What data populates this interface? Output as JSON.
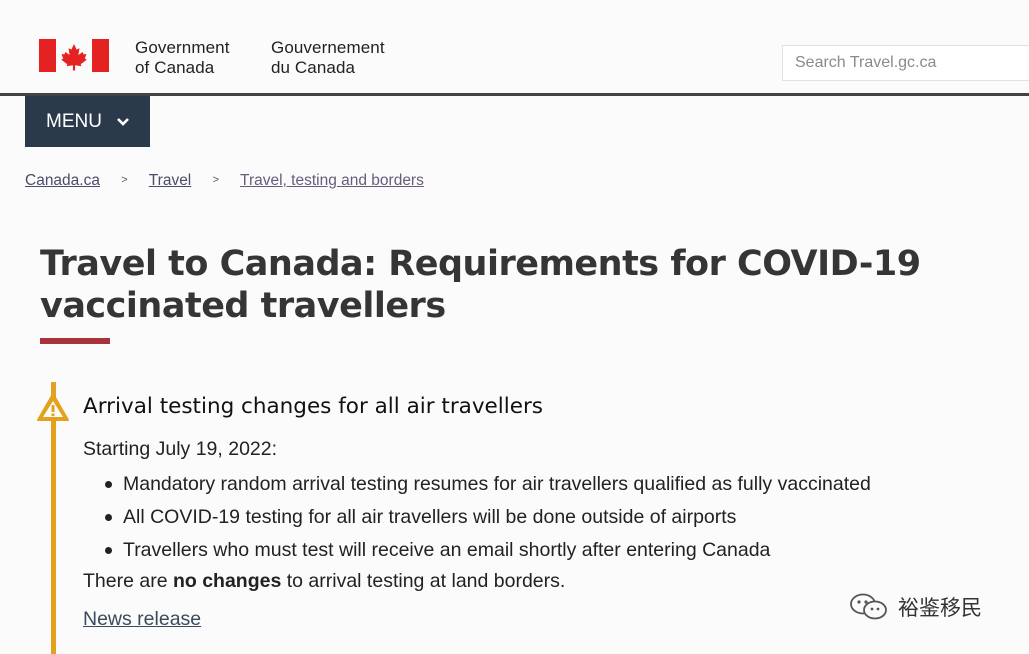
{
  "header": {
    "signature_en_line1": "Government",
    "signature_en_line2": "of Canada",
    "signature_fr_line1": "Gouvernement",
    "signature_fr_line2": "du Canada",
    "search_placeholder": "Search Travel.gc.ca"
  },
  "menu": {
    "label": "MENU"
  },
  "breadcrumb": {
    "items": [
      "Canada.ca",
      "Travel",
      "Travel, testing and borders"
    ],
    "separator": ">"
  },
  "page": {
    "title": "Travel to Canada: Requirements for COVID-19 vaccinated travellers"
  },
  "alert": {
    "title": "Arrival testing changes for all air travellers",
    "intro": "Starting July 19, 2022:",
    "bullets": [
      "Mandatory random arrival testing resumes for air travellers qualified as fully vaccinated",
      "All COVID-19 testing for all air travellers will be done outside of airports",
      "Travellers who must test will receive an email shortly after entering Canada"
    ],
    "note_prefix": "There are ",
    "note_bold": "no changes",
    "note_suffix": " to arrival testing at land borders.",
    "link": "News release"
  },
  "watermark": {
    "text": "裕鉴移民"
  },
  "colors": {
    "flag_red": "#e42221",
    "menu_bg": "#2b3a4a",
    "title_underline": "#a8333b",
    "alert_accent": "#e3a11d"
  },
  "icons": {
    "flag": "canada-flag-icon",
    "menu_chevron": "chevron-down-icon",
    "alert": "warning-triangle-icon",
    "watermark": "wechat-icon"
  }
}
